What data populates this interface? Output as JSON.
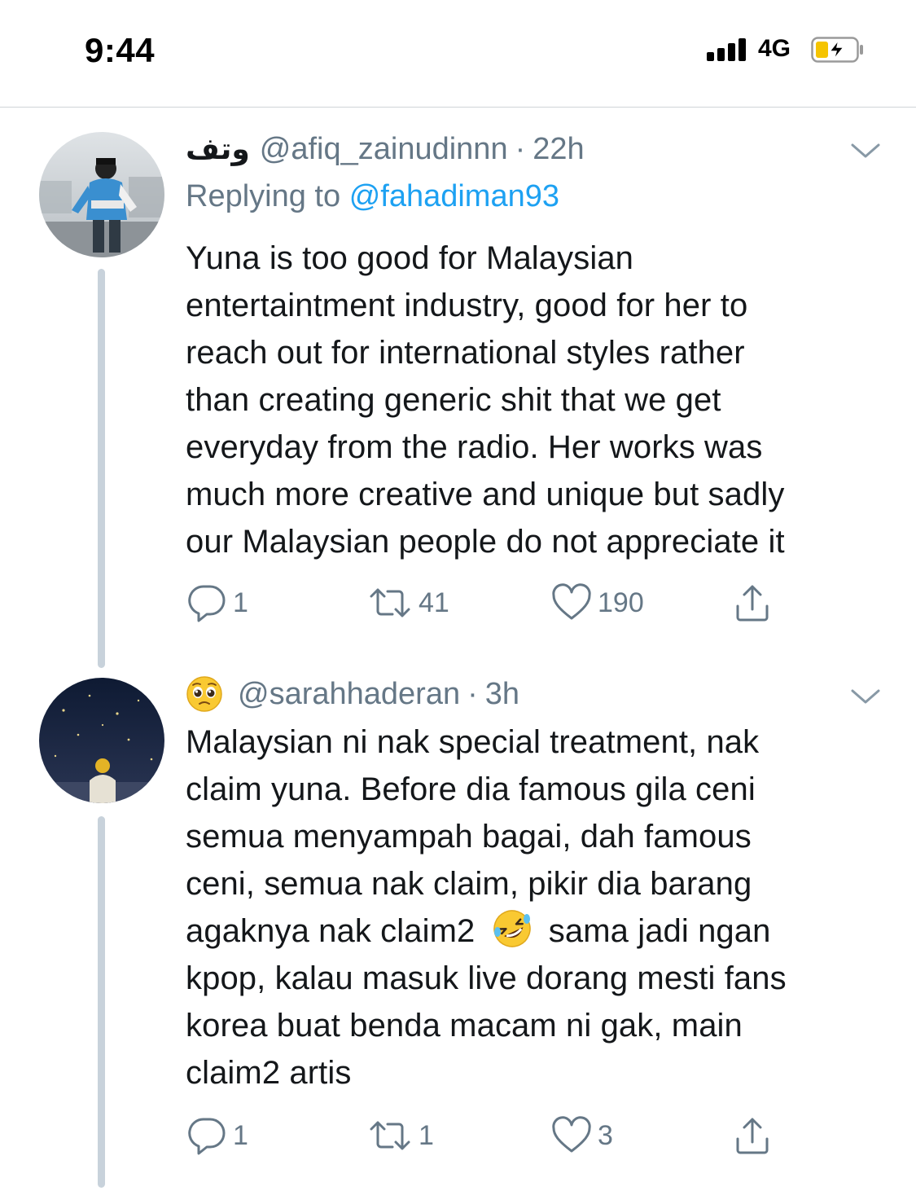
{
  "status_bar": {
    "time": "9:44",
    "network": "4G",
    "signal_icon": "cellular-signal-icon",
    "battery_icon": "battery-charging-icon"
  },
  "tweets": [
    {
      "display_name": "وتف",
      "handle": "@afiq_zainudinnn",
      "separator": "·",
      "time": "22h",
      "replying_prefix": "Replying to",
      "replying_to": "@fahadiman93",
      "text_lines": [
        "Yuna is too good for Malaysian",
        "entertaintment industry, good for her to",
        "reach out for international styles rather",
        "than creating generic shit that we get",
        "everyday from the radio. Her works was",
        "much more creative and unique but sadly",
        "our Malaysian people do not appreciate it"
      ],
      "replies": "1",
      "retweets": "41",
      "likes": "190"
    },
    {
      "display_name_emoji": "pleading-face-emoji",
      "handle": "@sarahhaderan",
      "separator": "·",
      "time": "3h",
      "text_lines": [
        "Malaysian ni nak special treatment, nak",
        "claim yuna. Before dia famous gila ceni",
        "semua menyampah bagai, dah famous",
        "ceni, semua nak claim, pikir dia barang",
        "agaknya nak claim2",
        "sama jadi ngan",
        "kpop, kalau masuk live dorang mesti fans",
        "korea buat benda macam ni gak, main",
        "claim2 artis"
      ],
      "inline_emoji": "rolling-on-floor-laughing-emoji",
      "replies": "1",
      "retweets": "1",
      "likes": "3"
    }
  ],
  "colors": {
    "text": "#14171a",
    "secondary": "#657786",
    "link": "#1da1f2",
    "thread_line": "#c8d2db",
    "divider": "#cfd4d8"
  }
}
